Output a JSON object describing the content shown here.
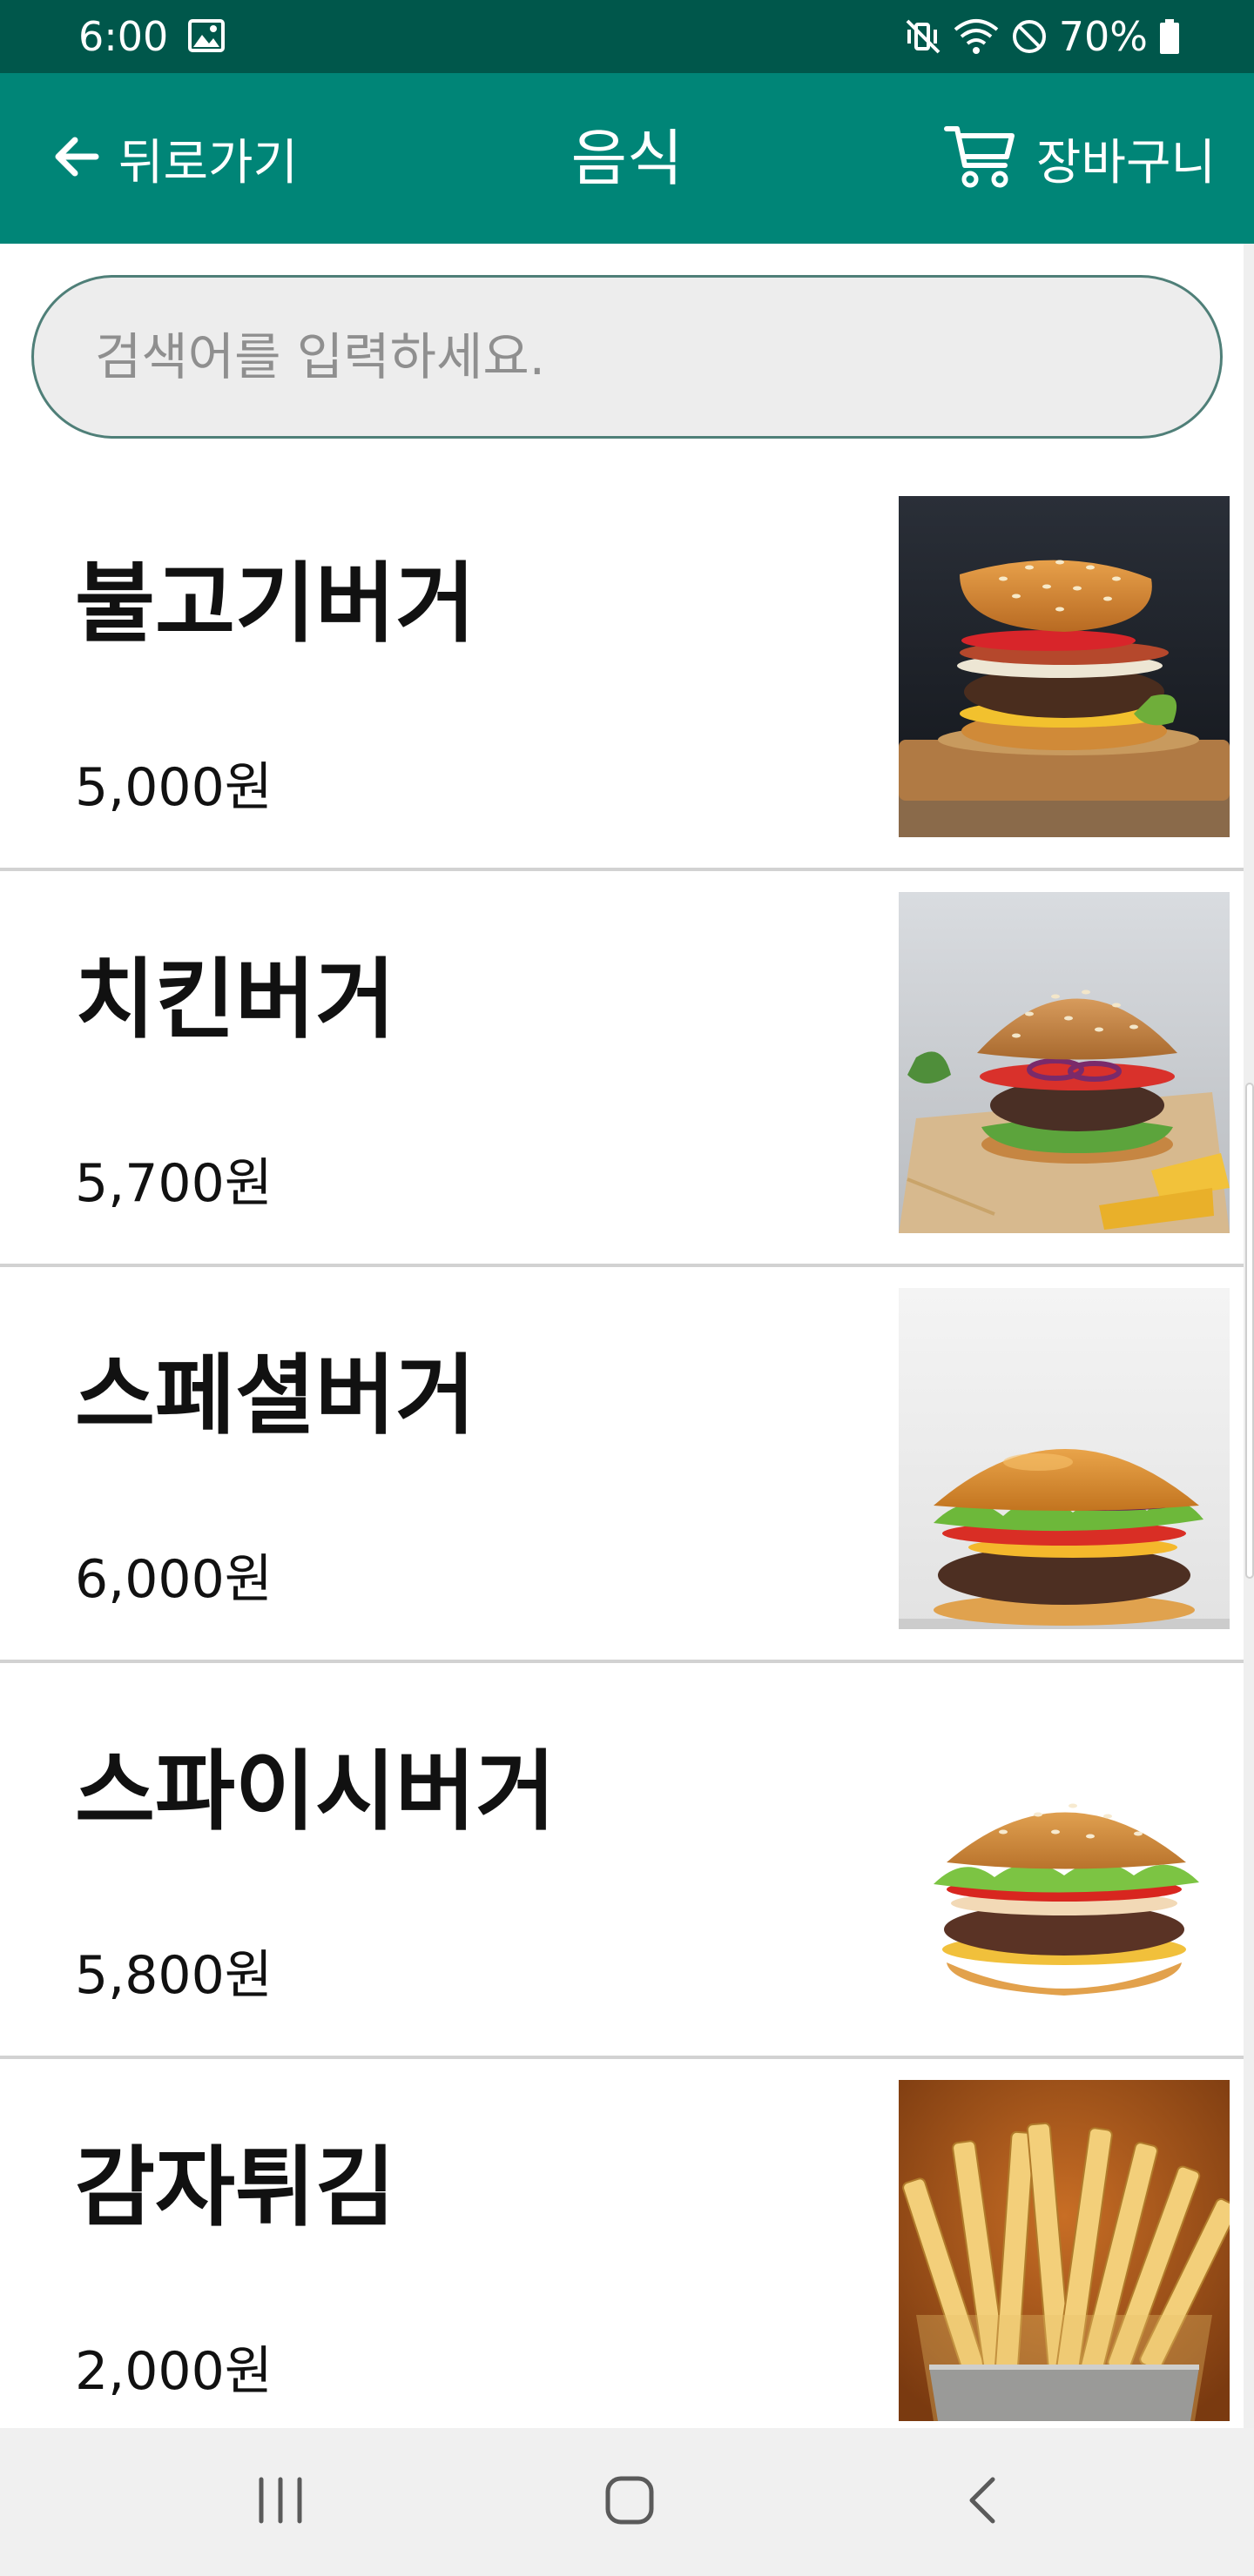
{
  "status_bar": {
    "time": "6:00",
    "battery": "70%",
    "icons": [
      "gallery-icon",
      "mute-vibrate-icon",
      "wifi-icon",
      "do-not-disturb-icon",
      "battery-icon"
    ]
  },
  "app_bar": {
    "back_label": "뒤로가기",
    "title": "음식",
    "cart_label": "장바구니",
    "icons": [
      "arrow-left-icon",
      "cart-icon"
    ],
    "background_color": "#008577",
    "status_bar_color": "#00574B"
  },
  "search": {
    "placeholder": "검색어를 입력하세요.",
    "value": ""
  },
  "products": [
    {
      "name": "불고기버거",
      "price": "5,000원",
      "image": "bulgogi-burger-photo"
    },
    {
      "name": "치킨버거",
      "price": "5,700원",
      "image": "chicken-burger-photo"
    },
    {
      "name": "스페셜버거",
      "price": "6,000원",
      "image": "special-burger-photo"
    },
    {
      "name": "스파이시버거",
      "price": "5,800원",
      "image": "spicy-burger-photo"
    },
    {
      "name": "감자튀김",
      "price": "2,000원",
      "image": "french-fries-photo"
    }
  ],
  "nav_bar": {
    "icons": [
      "recents-icon",
      "home-icon",
      "back-icon"
    ]
  }
}
